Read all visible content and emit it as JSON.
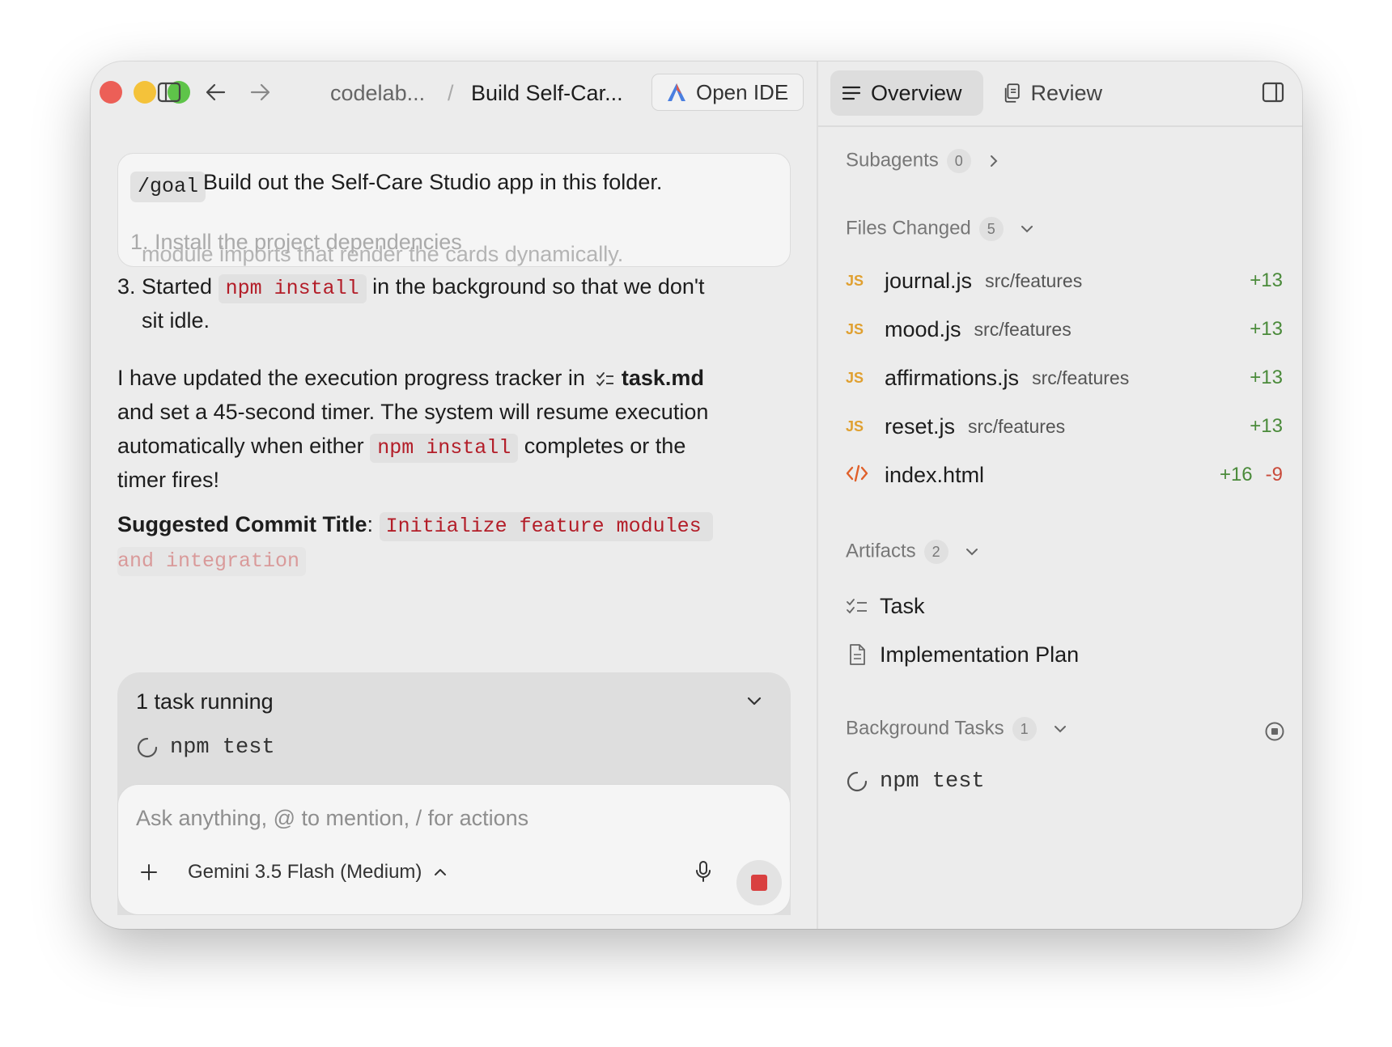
{
  "titlebar": {
    "crumb_project": "codelab...",
    "crumb_separator": "/",
    "crumb_conversation": "Build Self-Car...",
    "open_ide_label": "Open IDE"
  },
  "goal": {
    "command": "/goal",
    "text": "Build out the Self-Care Studio app in this folder.",
    "faded_line": "1. Install the project dependencies"
  },
  "message": {
    "faded_line": "module imports that render the cards dynamically.",
    "item3_num": "3.",
    "item3_before": "Started",
    "item3_code": "npm install",
    "item3_after": "in the background so that we don't",
    "item3_line2": "sit idle.",
    "para_l1_text": "I have updated the execution progress tracker in",
    "para_l1_file": "task.md",
    "para_l2": "and set a 45-second timer. The system will resume execution",
    "para_l3_before": "automatically when either",
    "para_l3_code": "npm install",
    "para_l3_after": "completes or the",
    "para_l4": "timer fires!",
    "commit_label": "Suggested Commit Title",
    "commit_colon": ":",
    "commit_code_l1": "Initialize feature modules",
    "commit_code_l2": "and integration"
  },
  "tasks": {
    "header": "1 task running",
    "items": [
      "npm test"
    ]
  },
  "composer": {
    "placeholder": "Ask anything, @ to mention, / for actions",
    "model": "Gemini 3.5 Flash (Medium)"
  },
  "right": {
    "tabs": [
      {
        "label": "Overview",
        "icon": "list-icon",
        "active": true
      },
      {
        "label": "Review",
        "icon": "review-doc-icon",
        "active": false
      }
    ],
    "subagents": {
      "label": "Subagents",
      "count": "0"
    },
    "files_changed": {
      "label": "Files Changed",
      "count": "5",
      "files": [
        {
          "name": "journal.js",
          "path": "src/features",
          "added": "+13",
          "removed": "",
          "type": "JS"
        },
        {
          "name": "mood.js",
          "path": "src/features",
          "added": "+13",
          "removed": "",
          "type": "JS"
        },
        {
          "name": "affirmations.js",
          "path": "src/features",
          "added": "+13",
          "removed": "",
          "type": "JS"
        },
        {
          "name": "reset.js",
          "path": "src/features",
          "added": "+13",
          "removed": "",
          "type": "JS"
        },
        {
          "name": "index.html",
          "path": "",
          "added": "+16",
          "removed": "-9",
          "type": "html"
        }
      ]
    },
    "artifacts": {
      "label": "Artifacts",
      "count": "2",
      "items": [
        {
          "label": "Task",
          "icon": "checklist-icon"
        },
        {
          "label": "Implementation Plan",
          "icon": "document-icon"
        }
      ]
    },
    "background_tasks": {
      "label": "Background Tasks",
      "count": "1",
      "items": [
        "npm test"
      ]
    }
  },
  "colors": {
    "close": "#ec5f57",
    "minimize": "#f4c23a",
    "zoom": "#5ec449",
    "code_text": "#b31d28",
    "added": "#4a8a3a",
    "removed": "#c94a3a",
    "js_badge": "#e0a030",
    "stop": "#d94040"
  }
}
